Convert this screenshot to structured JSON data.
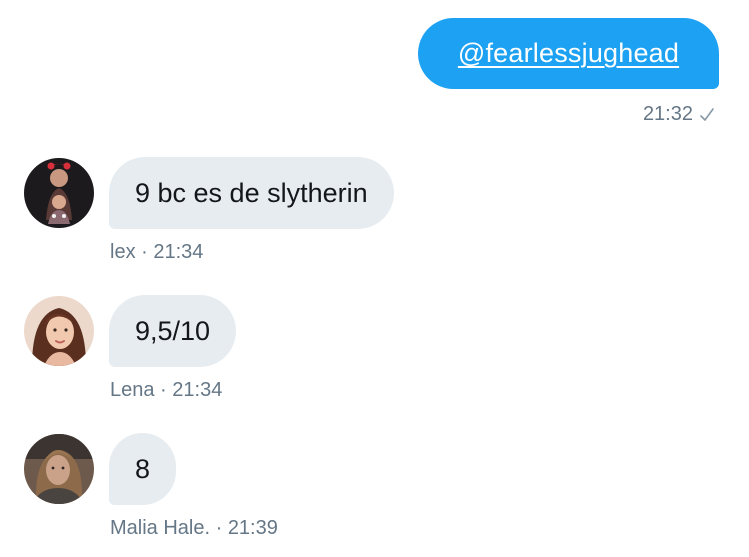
{
  "outgoing": {
    "text": "@fearlessjughead",
    "time": "21:32",
    "status_icon": "check-icon"
  },
  "messages": [
    {
      "text": "9 bc es de slytherin",
      "meta": "lex · 21:34",
      "avatar_icon": "avatar-lex"
    },
    {
      "text": "9,5/10",
      "meta": "Lena · 21:34",
      "avatar_icon": "avatar-lena"
    },
    {
      "text": "8",
      "meta": "Malia Hale. · 21:39",
      "avatar_icon": "avatar-malia"
    }
  ],
  "colors": {
    "accent": "#1da1f2",
    "incoming_bubble": "#e6ecf0",
    "meta_text": "#657786",
    "body_text": "#14171a"
  }
}
